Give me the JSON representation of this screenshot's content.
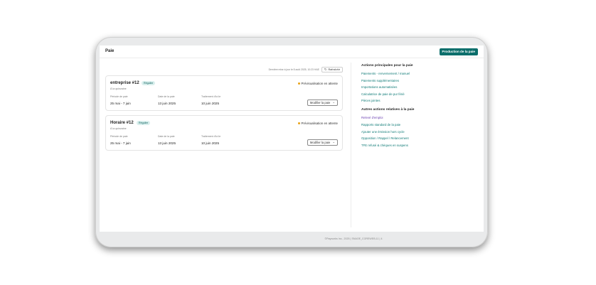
{
  "header": {
    "title": "Paie",
    "primary_button": "Production de la paie"
  },
  "refresh": {
    "last_update": "Dernière mise à jour le 8 août 2025, 10:23 HAE",
    "button_label": "Rafraîchir"
  },
  "payrolls": [
    {
      "name": "entreprise #12",
      "badge": "Régulier",
      "frequency": "À la quinzaine",
      "status": "Prévisualisation en attente",
      "period_label": "Période de paie",
      "period": "25 mai - 7 juin",
      "pay_date_label": "Date de la paie",
      "pay_date": "13 juin 2025",
      "processing_label": "Traitement d'ici le",
      "processing": "10 juin 2025",
      "modify_label": "Modifier la paie"
    },
    {
      "name": "Horaire #12",
      "badge": "Régulier",
      "frequency": "À la quinzaine",
      "status": "Prévisualisation en attente",
      "period_label": "Période de paie",
      "period": "25 mai - 7 juin",
      "pay_date_label": "Date de la paie",
      "pay_date": "13 juin 2025",
      "processing_label": "Traitement d'ici le",
      "processing": "10 juin 2025",
      "modify_label": "Modifier la paie"
    }
  ],
  "sidebar": {
    "main_actions_title": "Actions principales pour la paie",
    "main_actions": [
      "Paiements - renversement / manuel",
      "Paiements supplémentaires",
      "Importations automatisées",
      "Calculatrice de paie de pur férié",
      "Pièces jointes"
    ],
    "other_actions_title": "Autres actions relatives à la paie",
    "other_actions": [
      "Relevé d'emploi",
      "Rapports standard de la paie",
      "Ajouter une émission hors cycle",
      "Opposition / Rappel / Relancement",
      "TFE refusé & chèques en suspens"
    ]
  },
  "footer": "©Payworks Inc., 2025 | SNAOE_COREWEB-11 | 4",
  "colors": {
    "primary": "#0b6e6b",
    "link": "#0e7a76",
    "visited_link": "#6a3fb0",
    "status_pending": "#e8a317",
    "badge_bg": "#d9efed"
  }
}
